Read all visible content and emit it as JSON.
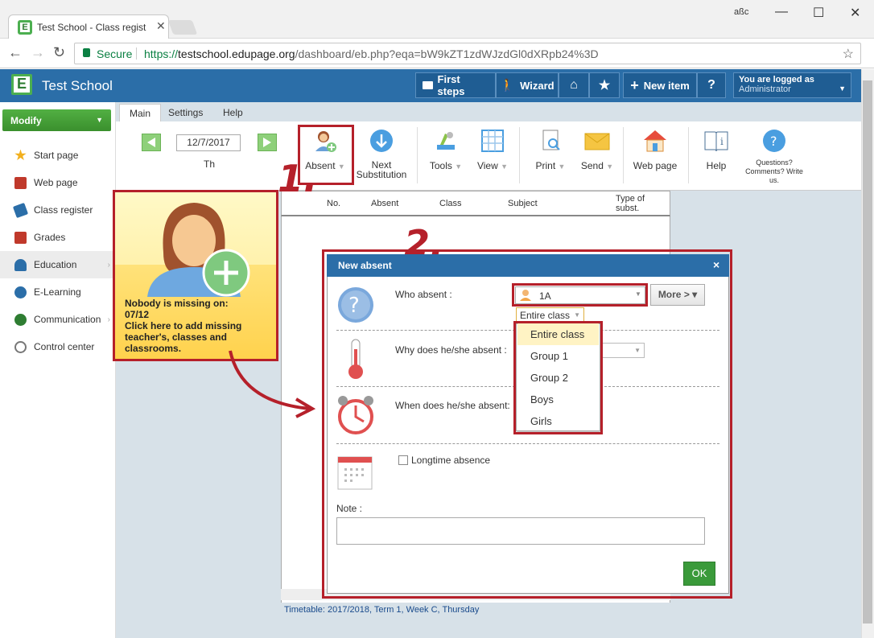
{
  "browser": {
    "tab_title": "Test School - Class regist",
    "secure_label": "Secure",
    "url_scheme": "https://",
    "url_host": "testschool.edupage.org",
    "url_path": "/dashboard/eb.php?eqa=bW9kZT1zdWJzdGl0dXRpb24%3D",
    "profile_label": "aßc"
  },
  "header": {
    "logo_letter": "E",
    "school_name": "Test School",
    "buttons": [
      "First steps",
      "Wizard",
      "New item",
      "?"
    ],
    "logged_line1": "You are logged as",
    "logged_line2": "Administrator"
  },
  "sidebar": {
    "modify_label": "Modify",
    "items": [
      {
        "label": "Start page",
        "icon": "star-icon",
        "color": "#f2b01e"
      },
      {
        "label": "Web page",
        "icon": "school-icon",
        "color": "#c0392b"
      },
      {
        "label": "Class register",
        "icon": "book-icon",
        "color": "#2b6ea8"
      },
      {
        "label": "Grades",
        "icon": "grades-icon",
        "color": "#c0392b"
      },
      {
        "label": "Education",
        "icon": "education-icon",
        "color": "#2b6ea8"
      },
      {
        "label": "E-Learning",
        "icon": "elearning-icon",
        "color": "#2b6ea8"
      },
      {
        "label": "Communication",
        "icon": "globe-icon",
        "color": "#2e7d32"
      },
      {
        "label": "Control center",
        "icon": "gear-icon",
        "color": "#777777"
      }
    ]
  },
  "ribbon": {
    "tabs": [
      "Main",
      "Settings",
      "Help"
    ],
    "date": "12/7/2017",
    "day": "Th",
    "absent_label": "Absent",
    "next_sub_line1": "Next",
    "next_sub_line2": "Substitution",
    "tools_label": "Tools",
    "view_label": "View",
    "print_label": "Print",
    "send_label": "Send",
    "webpage_label": "Web page",
    "help_label": "Help",
    "questions_line1": "Questions?",
    "questions_line2": "Comments? Write",
    "questions_line3": "us."
  },
  "table": {
    "columns": [
      "No.",
      "Absent",
      "Class",
      "Subject",
      "Type of",
      "subst."
    ],
    "footer": "Timetable: 2017/2018, Term 1, Week C, Thursday"
  },
  "tip": {
    "line1": "Nobody is missing on:",
    "line2": "07/12",
    "line3": "Click here to add missing",
    "line4": "teacher's, classes and",
    "line5": "classrooms."
  },
  "dialog": {
    "title": "New absent",
    "close": "×",
    "who_label": "Who absent :",
    "who_value": "1A",
    "more_label": "More > ▾",
    "sub_value": "Entire class",
    "why_label": "Why does he/she absent :",
    "when_label": "When does he/she absent:",
    "longtime_label": "Longtime absence",
    "note_label": "Note :",
    "ok_label": "OK",
    "options": [
      "Entire class",
      "Group 1",
      "Group 2",
      "Boys",
      "Girls"
    ]
  },
  "annotations": {
    "step1": "1.",
    "step2": "2."
  },
  "colors": {
    "accent_red": "#b5202a",
    "header_blue": "#2b6ea8",
    "green": "#4caf50"
  }
}
